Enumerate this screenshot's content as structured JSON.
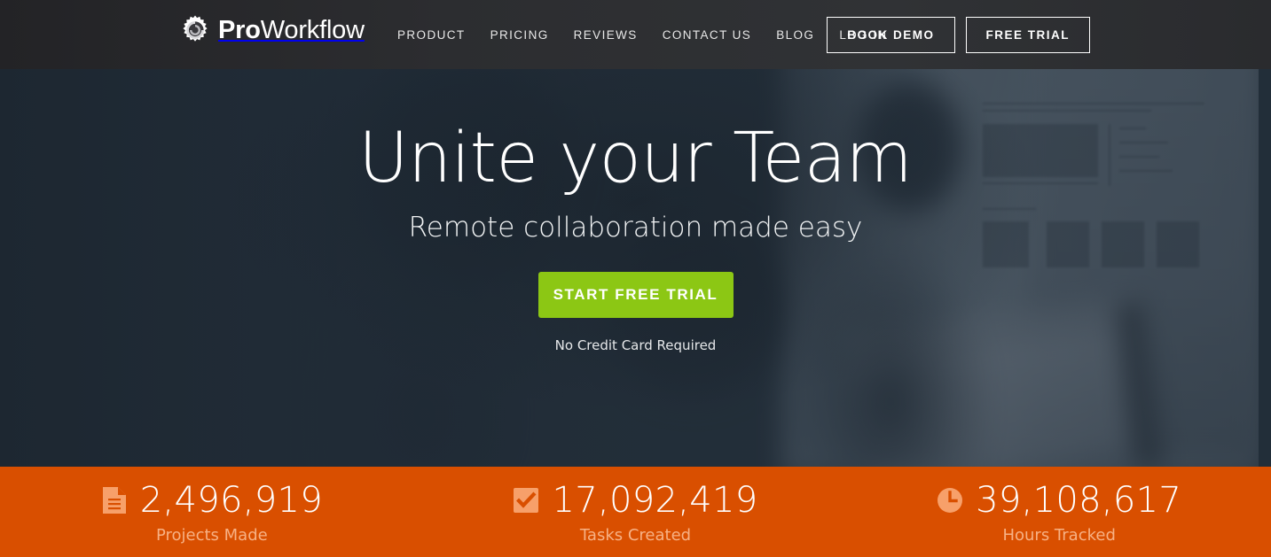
{
  "brand": {
    "name_bold": "Pro",
    "name_light": "Workflow",
    "logo_icon": "gear-icon"
  },
  "header": {
    "nav": [
      {
        "label": "PRODUCT",
        "name": "nav-product"
      },
      {
        "label": "PRICING",
        "name": "nav-pricing"
      },
      {
        "label": "REVIEWS",
        "name": "nav-reviews"
      },
      {
        "label": "CONTACT US",
        "name": "nav-contact-us"
      },
      {
        "label": "BLOG",
        "name": "nav-blog"
      },
      {
        "label": "LOG IN",
        "name": "nav-log-in"
      }
    ],
    "book_demo": "BOOK DEMO",
    "free_trial": "FREE TRIAL",
    "background_color": "#2c2d30"
  },
  "hero": {
    "headline": "Unite your Team",
    "subheadline": "Remote collaboration made easy",
    "cta_label": "START FREE TRIAL",
    "cta_color": "#8cc714",
    "cta_note": "No Credit Card Required",
    "background_color": "#212d38"
  },
  "stats": {
    "background_color": "#d94f00",
    "icon_color": "#f7a06a",
    "label_color": "#f7b184",
    "items": [
      {
        "icon": "document-icon",
        "value": "2,496,919",
        "label": "Projects Made"
      },
      {
        "icon": "checkbox-icon",
        "value": "17,092,419",
        "label": "Tasks Created"
      },
      {
        "icon": "clock-icon",
        "value": "39,108,617",
        "label": "Hours Tracked"
      }
    ]
  }
}
